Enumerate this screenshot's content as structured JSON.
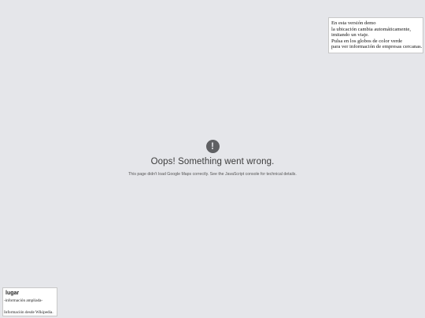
{
  "demo_note": {
    "lines": [
      "En esta versión demo",
      "la ubicación cambia automáticamente,",
      "imitando un viaje.",
      "Pulsa en los globos de color verde",
      "para ver información de empresas cercanas."
    ]
  },
  "error": {
    "icon": "exclamation-icon",
    "icon_glyph": "!",
    "title": "Oops! Something went wrong.",
    "detail": "This page didn't load Google Maps correctly. See the JavaScript console for technical details."
  },
  "info_box": {
    "title": "lugar",
    "more": "-información ampliada-",
    "source": "Información desde Wikipedia."
  },
  "colors": {
    "background": "#e5e6ea",
    "icon": "#5f6063"
  }
}
